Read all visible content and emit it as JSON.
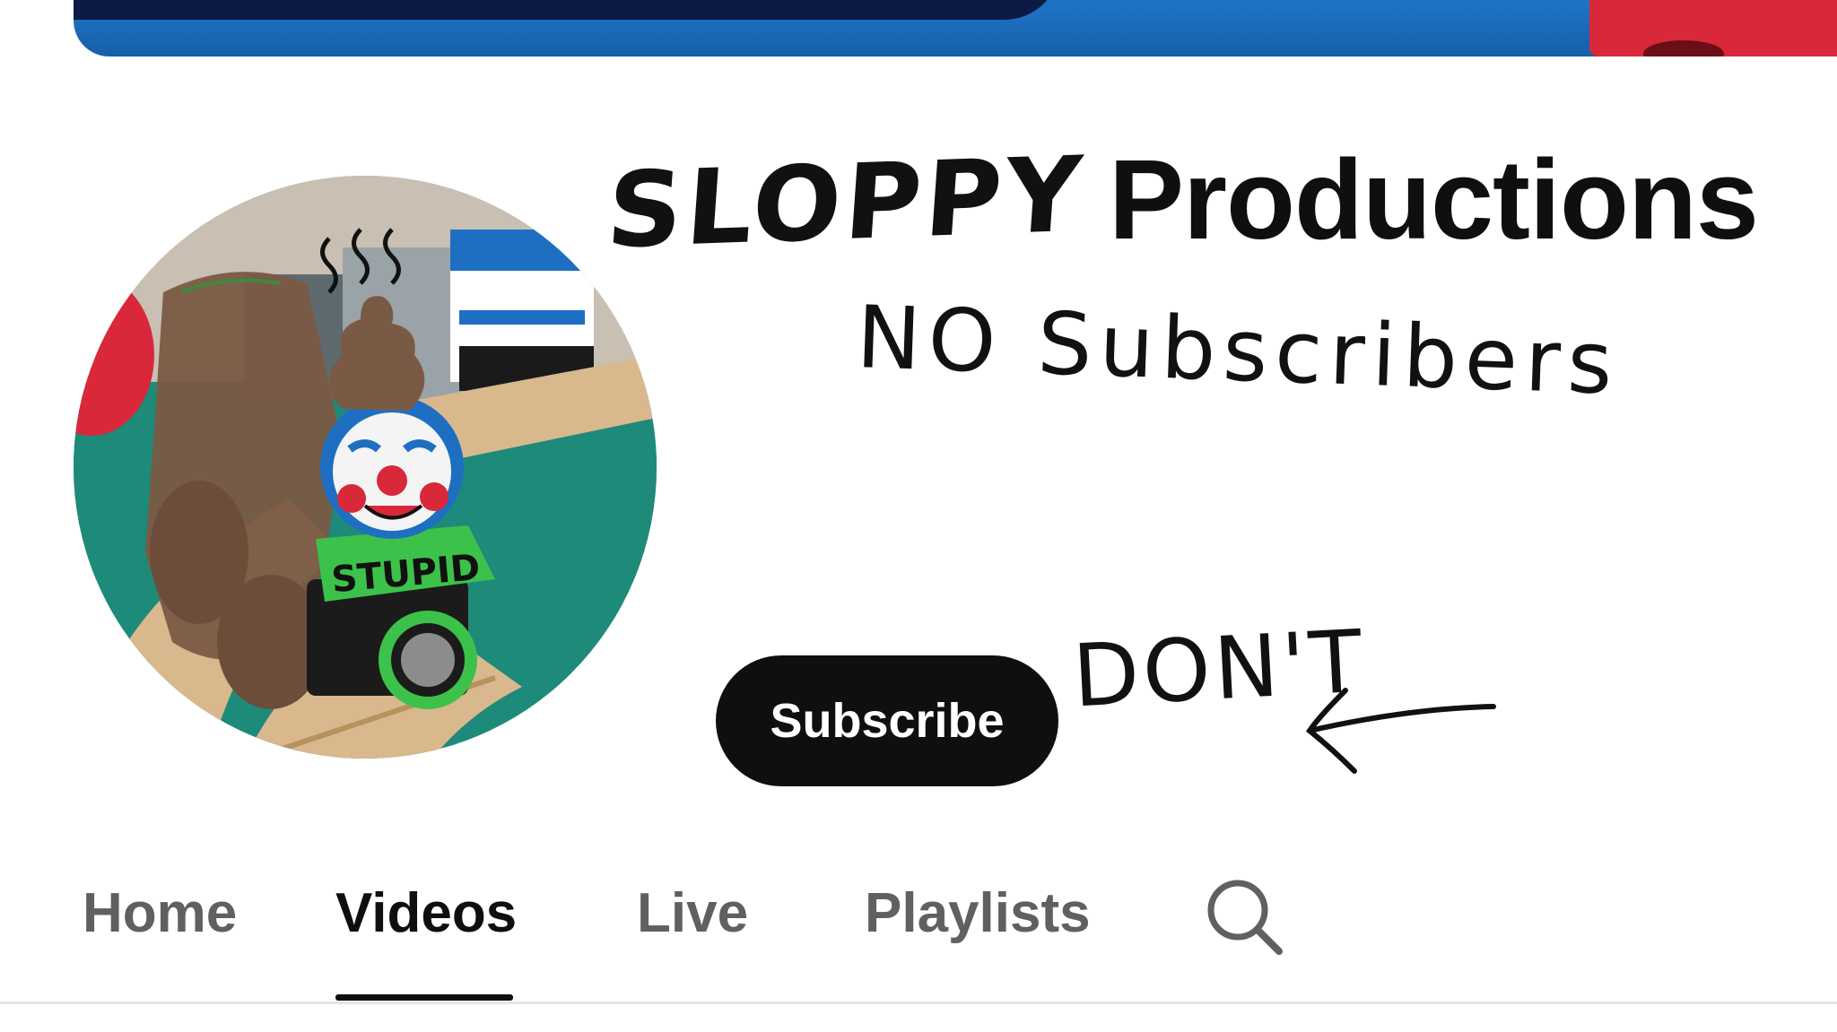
{
  "channel": {
    "name_handwritten": "SLOPPY",
    "name_typed": "Productions",
    "subscribers_handwritten": "NO Subscribers"
  },
  "actions": {
    "subscribe_label": "Subscribe",
    "annotation_text": "DON'T"
  },
  "avatar": {
    "sign_text": "STUPID"
  },
  "tabs": [
    {
      "label": "Home",
      "active": false
    },
    {
      "label": "Videos",
      "active": true
    },
    {
      "label": "Live",
      "active": false
    },
    {
      "label": "Playlists",
      "active": false
    }
  ],
  "icons": {
    "search": "search-icon",
    "arrow": "arrow-left-icon"
  },
  "colors": {
    "subscribe_bg": "#0f0f0f",
    "banner_blue": "#1e6fc1",
    "banner_red": "#d8283a",
    "tab_inactive": "#606060",
    "tab_active": "#0f0f0f"
  }
}
